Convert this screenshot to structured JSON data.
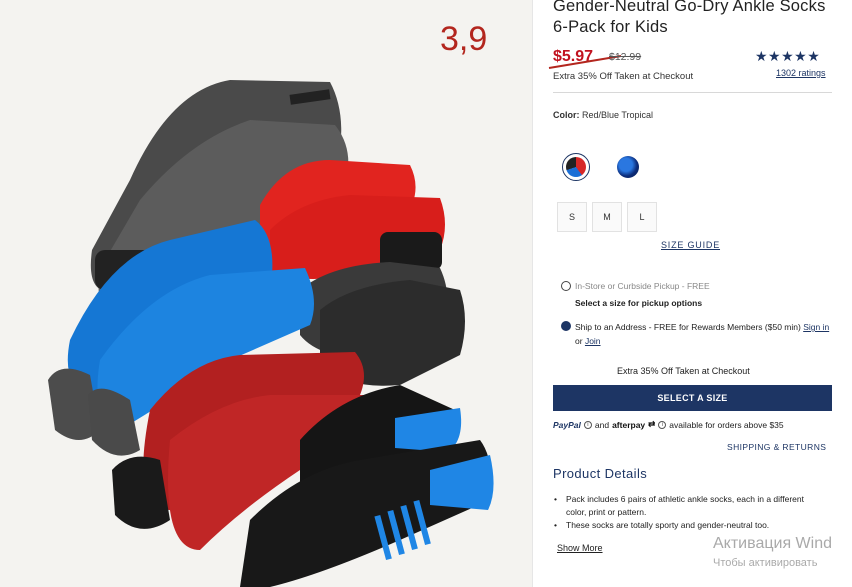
{
  "product": {
    "title": "Gender-Neutral Go-Dry Ankle Socks 6-Pack for Kids",
    "sale_price": "$5.97",
    "original_price": "$12.99",
    "promo_note": "Extra 35% Off Taken at Checkout",
    "stars": "★★★★★",
    "ratings_link": "1302 ratings"
  },
  "annotation": {
    "handwritten_number": "3,9"
  },
  "color": {
    "label": "Color:",
    "value": "Red/Blue Tropical",
    "swatches": [
      "Red/Blue Tropical",
      "Blue"
    ]
  },
  "sizes": [
    "S",
    "M",
    "L"
  ],
  "size_guide": "SIZE GUIDE",
  "fulfillment": {
    "pickup_label": "In-Store or Curbside Pickup - FREE",
    "pickup_sub": "Select a size for pickup options",
    "ship_label": "Ship to an Address - FREE for Rewards Members ($50 min)",
    "sign_in": "Sign in",
    "or": "or",
    "join": "Join"
  },
  "extra_promo": "Extra 35% Off Taken at Checkout",
  "select_button": "SELECT A SIZE",
  "payments": {
    "paypal": "PayPal",
    "and": "and",
    "afterpay": "afterpay",
    "afterpay_arrow": "⇄",
    "note": "available for orders above $35"
  },
  "shipping_link": "SHIPPING & RETURNS",
  "details": {
    "title": "Product Details",
    "bullets": [
      "Pack includes 6 pairs of athletic ankle socks, each in a different color, print or pattern.",
      "These socks are totally sporty and gender-neutral too."
    ],
    "show_more": "Show More"
  },
  "watermark": {
    "line1": "Активация Wind",
    "line2": "Чтобы активировать"
  }
}
